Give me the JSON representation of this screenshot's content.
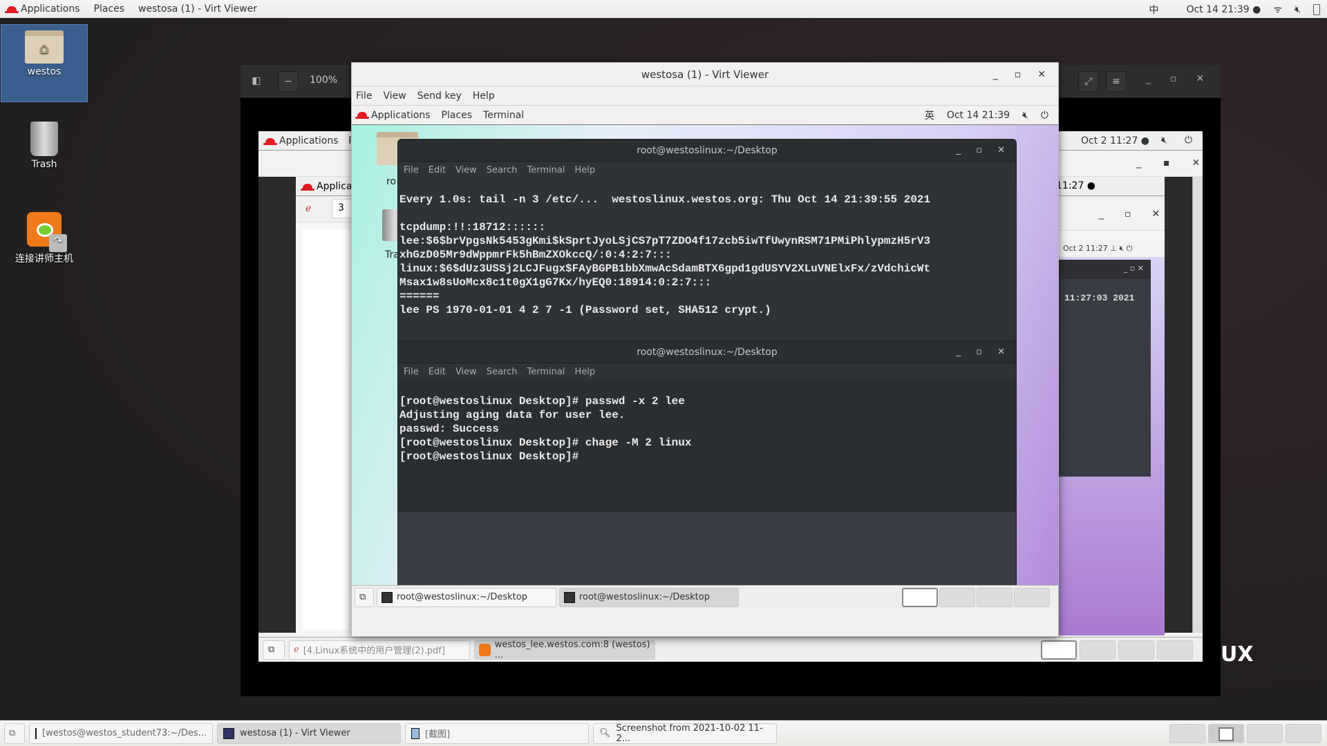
{
  "host_topbar": {
    "applications": "Applications",
    "places": "Places",
    "active_window": "westosa (1) - Virt Viewer",
    "input_method": "中",
    "clock": "Oct 14  21:39 ●"
  },
  "desktop_icons": [
    {
      "label": "westos",
      "icon": "home-folder-icon"
    },
    {
      "label": "Trash",
      "icon": "trash-icon"
    },
    {
      "label": "连接讲师主机",
      "icon": "tiger-vnc-icon"
    }
  ],
  "outer_viewer": {
    "zoom": "100%",
    "bg_text": "UX"
  },
  "layer2": {
    "applications": "Applications",
    "places_partial": "P",
    "clock": "Oct 2  11:27 ●",
    "clock2": "11:27 ●",
    "clock3": "Oct 2  11:27",
    "inner_app": "Applicat",
    "page_field": "3",
    "inner_terminal_time": "11:27:03 2021"
  },
  "virt_viewer": {
    "title": "westosa (1) - Virt Viewer",
    "menu": [
      "File",
      "View",
      "Send key",
      "Help"
    ],
    "guest_bar": {
      "applications": "Applications",
      "places": "Places",
      "terminal": "Terminal",
      "input_method": "英",
      "clock": "Oct 14  21:39"
    },
    "guest_desktop_icons": [
      "ro",
      "Tra"
    ]
  },
  "terminal1": {
    "title": "root@westoslinux:~/Desktop",
    "menu": [
      "File",
      "Edit",
      "View",
      "Search",
      "Terminal",
      "Help"
    ],
    "lines": [
      "Every 1.0s: tail -n 3 /etc/...  westoslinux.westos.org: Thu Oct 14 21:39:55 2021",
      "",
      "tcpdump:!!:18712::::::",
      "lee:$6$brVpgsNk5453gKmi$kSprtJyoLSjCS7pT7ZDO4f17zcb5iwTfUwynRSM71PMiPhlypmzH5rV3",
      "xhGzD05Mr9dWppmrFk5hBmZXOkccQ/:0:4:2:7:::",
      "linux:$6$dUz3USSj2LCJFugx$FAyBGPB1bbXmwAcSdamBTX6gpd1gdUSYV2XLuVNElxFx/zVdchicWt",
      "Msax1w8sUoMcx8c1t0gX1gG7Kx/hyEQ0:18914:0:2:7:::",
      "======",
      "lee PS 1970-01-01 4 2 7 -1 (Password set, SHA512 crypt.)"
    ]
  },
  "terminal2": {
    "title": "root@westoslinux:~/Desktop",
    "menu": [
      "File",
      "Edit",
      "View",
      "Search",
      "Terminal",
      "Help"
    ],
    "lines": [
      "[root@westoslinux Desktop]# passwd -x 2 lee",
      "Adjusting aging data for user lee.",
      "passwd: Success",
      "[root@westoslinux Desktop]# chage -M 2 linux",
      "[root@westoslinux Desktop]#"
    ]
  },
  "guest_taskbar": [
    {
      "label": "root@westoslinux:~/Desktop",
      "active": false
    },
    {
      "label": "root@westoslinux:~/Desktop",
      "active": true
    }
  ],
  "layer2_taskbar": [
    {
      "label": "[4.Linux系统中的用户管理(2).pdf]",
      "active": false
    },
    {
      "label": "westos_lee.westos.com:8 (westos) ...",
      "active": true
    }
  ],
  "host_taskbar": [
    {
      "label": "[westos@westos_student73:~/Des...",
      "active": false
    },
    {
      "label": "westosa (1) - Virt Viewer",
      "active": true
    },
    {
      "label": "[截图]",
      "active": false
    },
    {
      "label": "Screenshot from 2021-10-02 11-2...",
      "active": false
    }
  ]
}
